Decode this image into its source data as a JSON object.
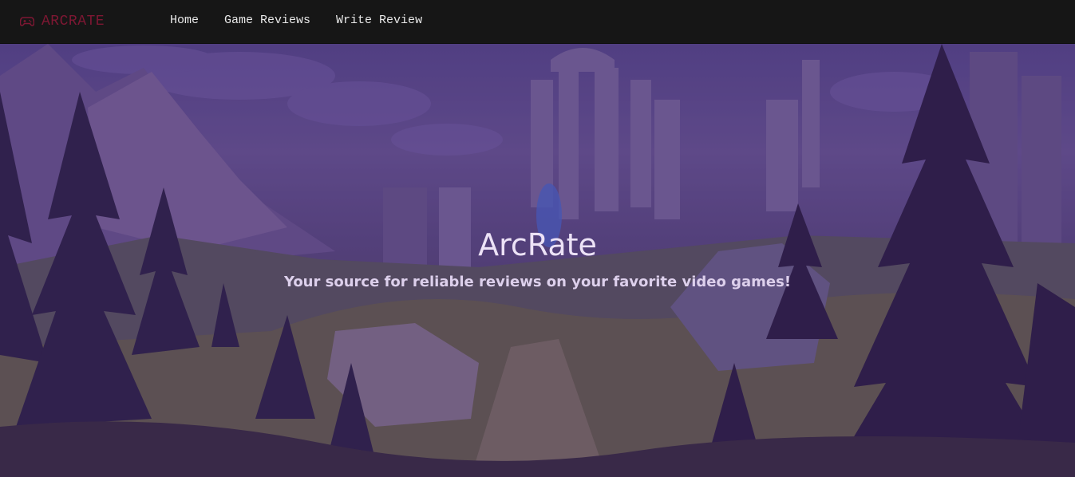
{
  "navbar": {
    "brand_text": "ARCRATE",
    "brand_icon": "gamepad-icon",
    "brand_color": "#7e1733",
    "links": [
      {
        "label": "Home"
      },
      {
        "label": "Game Reviews"
      },
      {
        "label": "Write Review"
      }
    ]
  },
  "hero": {
    "title": "ArcRate",
    "subtitle": "Your source for reliable reviews on your favorite video games!",
    "overlay_color": "#3a1e6e"
  }
}
